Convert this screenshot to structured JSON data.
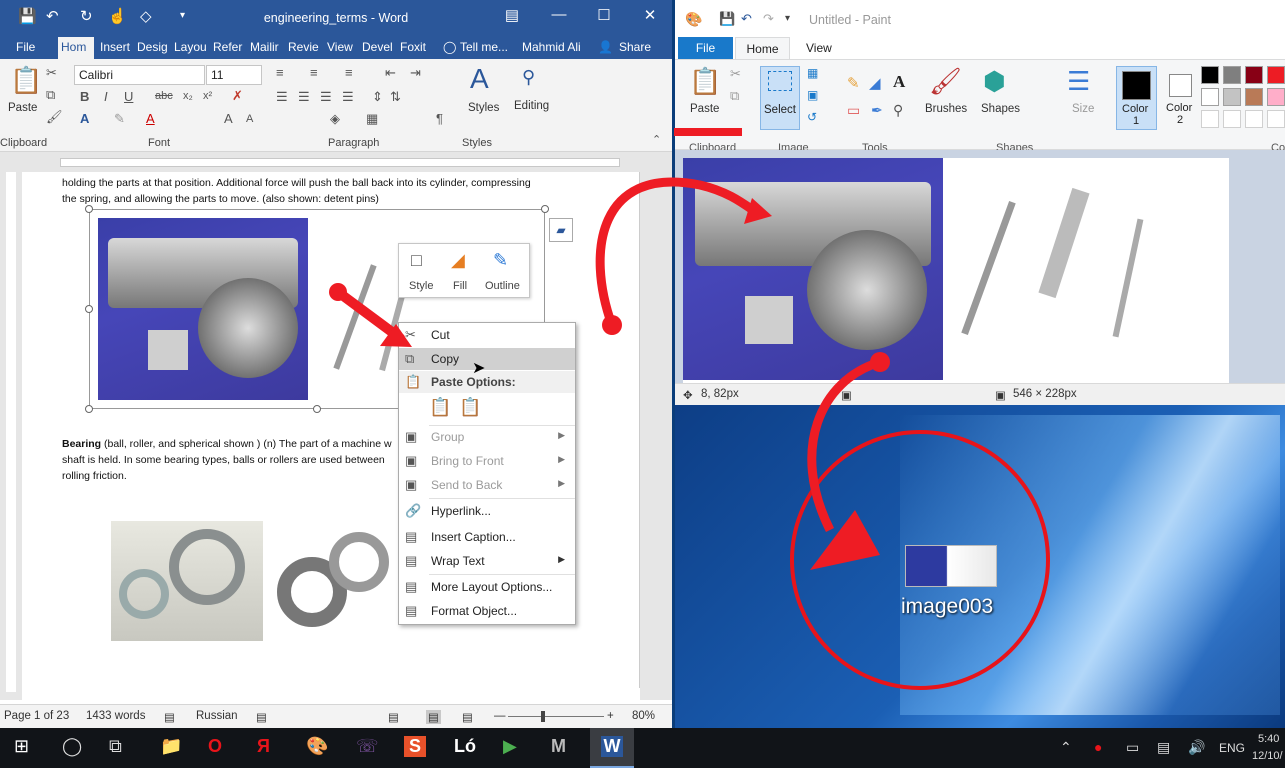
{
  "word": {
    "title": "engineering_terms - Word",
    "tabs": [
      "File",
      "Hom",
      "Insert",
      "Desig",
      "Layou",
      "Refer",
      "Mailir",
      "Revie",
      "View",
      "Devel",
      "Foxit"
    ],
    "tell_me": "Tell me...",
    "user": "Mahmid Ali",
    "share": "Share",
    "ribbon": {
      "paste": "Paste",
      "font_name": "Calibri",
      "font_size": "11",
      "styles": "Styles",
      "editing": "Editing",
      "groups": {
        "clipboard": "Clipboard",
        "font": "Font",
        "paragraph": "Paragraph",
        "styles": "Styles"
      }
    },
    "doc": {
      "line1": "holding the parts at that position. Additional force will push the ball back into its cylinder, compressing",
      "line2": "the spring, and allowing the parts to move. (also shown: detent pins)",
      "bearing_term": "Bearing",
      "bearing_rest": " (ball, roller, and spherical shown )  (n)  The part of a machine w",
      "bearing_line2": "shaft is held.  In some bearing types, balls or rollers are used between",
      "bearing_line3": "rolling friction."
    },
    "mini_toolbar": [
      "Style",
      "Fill",
      "Outline"
    ],
    "context_menu": {
      "cut": "Cut",
      "copy": "Copy",
      "paste_options": "Paste Options:",
      "group": "Group",
      "bring_to_front": "Bring to Front",
      "send_to_back": "Send to Back",
      "hyperlink": "Hyperlink...",
      "insert_caption": "Insert Caption...",
      "wrap_text": "Wrap Text",
      "more_layout": "More Layout Options...",
      "format_object": "Format Object..."
    },
    "status": {
      "page": "Page 1 of 23",
      "words": "1433 words",
      "language": "Russian",
      "zoom": "80%"
    }
  },
  "paint": {
    "title": "Untitled - Paint",
    "tabs": [
      "File",
      "Home",
      "View"
    ],
    "ribbon": {
      "paste": "Paste",
      "select": "Select",
      "brushes": "Brushes",
      "shapes": "Shapes",
      "size": "Size",
      "color1": "Color\n1",
      "color1_a": "Color",
      "color1_b": "1",
      "color2_a": "Color",
      "color2_b": "2",
      "groups": {
        "clipboard": "Clipboard",
        "image": "Image",
        "tools": "Tools",
        "shapes": "Shapes",
        "colors": "Co"
      }
    },
    "palette": [
      "#000000",
      "#7f7f7f",
      "#880015",
      "#ed1c24",
      "#ffffff",
      "#c3c3c3",
      "#b97a57",
      "#ffaec9"
    ],
    "status": {
      "position": "8, 82px",
      "size": "546 × 228px"
    }
  },
  "desktop": {
    "icon_label": "image003"
  },
  "taskbar": {
    "lang": "ENG",
    "time": "5:40",
    "date": "12/10/"
  }
}
